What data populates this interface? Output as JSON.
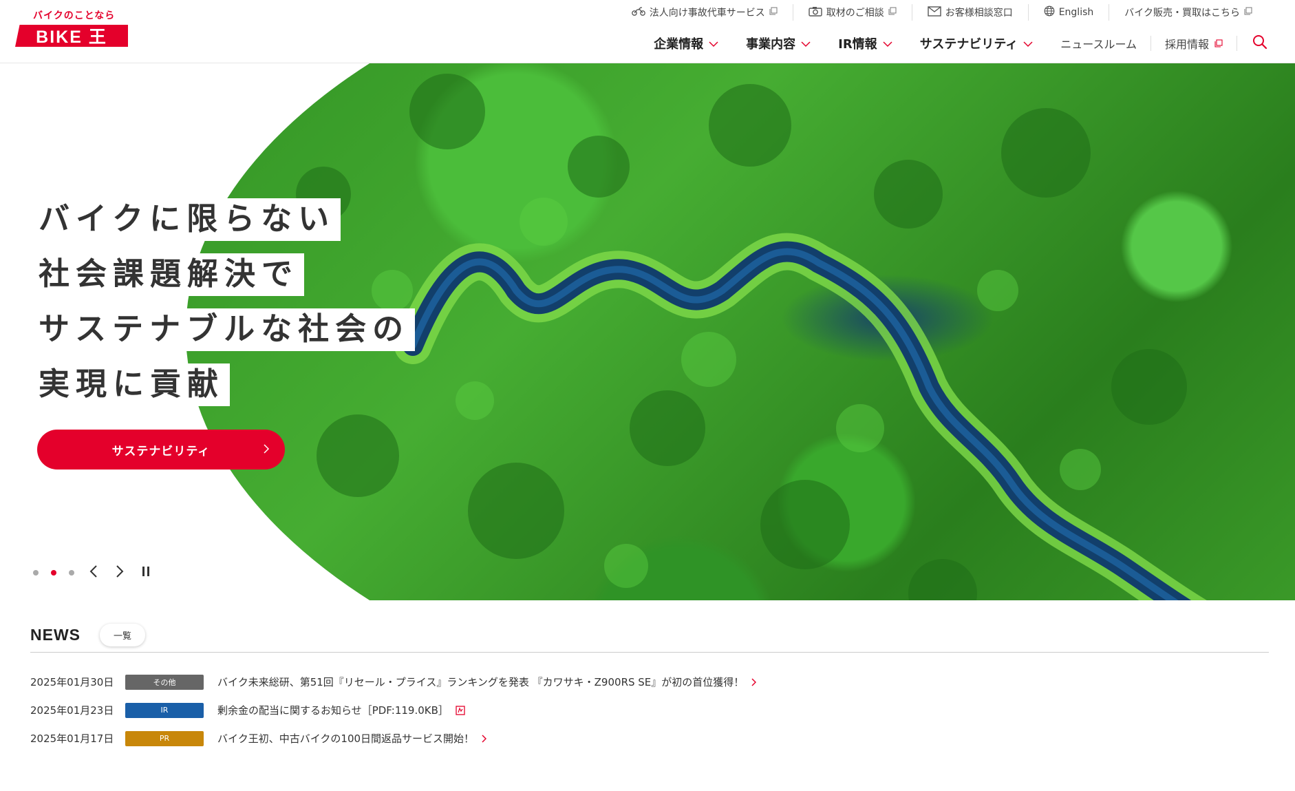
{
  "logo": {
    "tagline": "バイクのことなら",
    "brand": "BIKE 王"
  },
  "utility_nav": [
    {
      "label": "法人向け事故代車サービス",
      "icon": "motorcycle-icon"
    },
    {
      "label": "取材のご相談",
      "icon": "camera-icon"
    },
    {
      "label": "お客様相談窓口",
      "icon": "mail-icon"
    },
    {
      "label": "English",
      "icon": "globe-icon"
    },
    {
      "label": "バイク販売・買取はこちら",
      "icon": "external-link-icon"
    }
  ],
  "main_nav": [
    {
      "label": "企業情報"
    },
    {
      "label": "事業内容"
    },
    {
      "label": "IR情報"
    },
    {
      "label": "サステナビリティ"
    },
    {
      "label": "ニュースルーム"
    },
    {
      "label": "採用情報"
    }
  ],
  "hero": {
    "lines": [
      "バイクに限らない",
      "社会課題解決で",
      "サステナブルな社会の",
      "実現に貢献"
    ],
    "cta_label": "サステナビリティ",
    "slides": 3,
    "active_slide": 2
  },
  "news": {
    "title": "NEWS",
    "all_label": "一覧",
    "items": [
      {
        "date": "2025年01月30日",
        "tag": "その他",
        "tag_color": "#666666",
        "text": "バイク未来総研、第51回『リセール・プライス』ランキングを発表 『カワサキ・Z900RS SE』が初の首位獲得！",
        "icon": "chevron-right-icon"
      },
      {
        "date": "2025年01月23日",
        "tag": "IR",
        "tag_color": "#1a5fa8",
        "text": "剰余金の配当に関するお知らせ［PDF:119.0KB］",
        "icon": "pdf-icon"
      },
      {
        "date": "2025年01月17日",
        "tag": "PR",
        "tag_color": "#c8870a",
        "text": "バイク王初、中古バイクの100日間返品サービス開始！",
        "icon": "chevron-right-icon"
      }
    ]
  },
  "colors": {
    "brand_red": "#e4002b"
  }
}
